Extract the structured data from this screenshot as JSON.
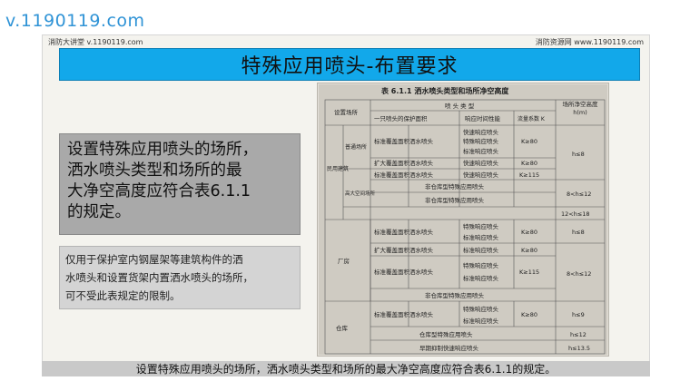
{
  "watermark": "v.1190119.com",
  "header": {
    "left": "消防大讲堂 v.1190119.com",
    "right": "消防资源网 www.1190119.com"
  },
  "title": "特殊应用喷头-布置要求",
  "main_text": [
    "设置特殊应用喷头的场所，",
    "洒水喷头类型和场所的最",
    "大净空高度应符合表6.1.1",
    "的规定。"
  ],
  "note_text": [
    "仅用于保护室内钢屋架等建筑构件的洒",
    "水喷头和设置货架内置洒水喷头的场所，",
    "可不受此表规定的限制。"
  ],
  "table": {
    "caption": "表 6.1.1   洒水喷头类型和场所净空高度",
    "headers": {
      "place": "设置场所",
      "sprinkler_type": "喷 头 类 型",
      "coverage": "一只喷头的保护面积",
      "response": "响应时间性能",
      "k": "流量系数 K",
      "height": "场所净空高度 h(m)"
    },
    "labels": {
      "civil": "民用建筑",
      "ordinary": "普通场所",
      "tall": "高大空间场所",
      "plant": "厂房",
      "warehouse": "仓库"
    },
    "rows": [
      {
        "coverage": "标准覆盖面积洒水喷头",
        "response": [
          "快速响应喷头",
          "特殊响应喷头",
          "标准响应喷头"
        ],
        "k": "K≥80"
      },
      {
        "coverage": "扩大覆盖面积洒水喷头",
        "response": [
          "快速响应喷头"
        ],
        "k": "K≥80"
      },
      {
        "coverage": "标准覆盖面积洒水喷头",
        "response": [
          "快速响应喷头"
        ],
        "k": "K≥115"
      },
      {
        "full": "非仓库型特殊应用喷头"
      },
      {
        "full": "非仓库型特殊应用喷头"
      },
      {
        "coverage": "标准覆盖面积洒水喷头",
        "response": [
          "特殊响应喷头",
          "标准响应喷头"
        ],
        "k": "K≥80"
      },
      {
        "coverage": "扩大覆盖面积洒水喷头",
        "response": [
          "标准响应喷头"
        ],
        "k": "K≥80"
      },
      {
        "coverage": "标准覆盖面积洒水喷头",
        "response": [
          "特殊响应喷头",
          "标准响应喷头"
        ],
        "k": "K≥115"
      },
      {
        "full": "非仓库型特殊应用喷头"
      },
      {
        "coverage": "标准覆盖面积洒水喷头",
        "response": [
          "特殊响应喷头",
          "标准响应喷头"
        ],
        "k": "K≥80"
      },
      {
        "full": "仓库型特殊应用喷头"
      },
      {
        "full": "早期抑制快速响应喷头"
      }
    ],
    "heights": [
      "h≤8",
      "8<h≤12",
      "12<h≤18",
      "h≤8",
      "8<h≤12",
      "h≤9",
      "h≤12",
      "h≤13.5"
    ]
  },
  "caption": "设置特殊应用喷头的场所，洒水喷头类型和场所的最大净空高度应符合表6.1.1的规定。"
}
